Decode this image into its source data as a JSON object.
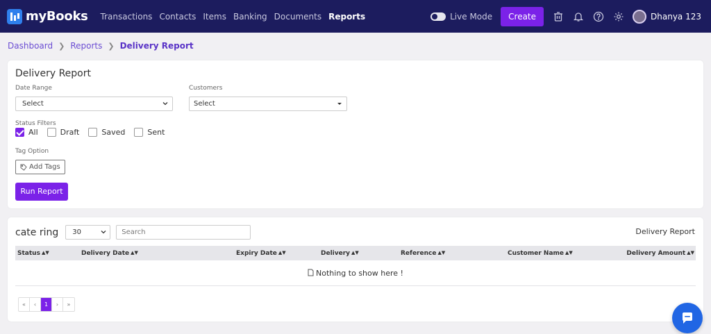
{
  "app": {
    "name": "myBooks"
  },
  "nav": {
    "links": [
      "Transactions",
      "Contacts",
      "Items",
      "Banking",
      "Documents",
      "Reports"
    ],
    "active": "Reports",
    "live_mode_label": "Live Mode",
    "create_label": "Create",
    "user_name": "Dhanya 123"
  },
  "breadcrumb": [
    "Dashboard",
    "Reports",
    "Delivery Report"
  ],
  "filters": {
    "title": "Delivery Report",
    "date_range_label": "Date Range",
    "date_range_value": "Select",
    "customers_label": "Customers",
    "customers_value": "Select",
    "status_label": "Status Filters",
    "statuses": [
      {
        "label": "All",
        "checked": true
      },
      {
        "label": "Draft",
        "checked": false
      },
      {
        "label": "Saved",
        "checked": false
      },
      {
        "label": "Sent",
        "checked": false
      }
    ],
    "tag_label": "Tag Option",
    "add_tags_label": "Add Tags",
    "run_label": "Run Report"
  },
  "table": {
    "title": "cate ring",
    "page_size": "30",
    "search_placeholder": "Search",
    "right_title": "Delivery Report",
    "columns": [
      "Status",
      "Delivery Date",
      "Expiry Date",
      "Delivery",
      "Reference",
      "Customer Name",
      "Delivery Amount"
    ],
    "empty_text": "Nothing to show here !",
    "pagination": [
      "«",
      "‹",
      "1",
      "›",
      "»"
    ],
    "current_page": "1"
  },
  "colors": {
    "nav_bg": "#1c1c5e",
    "accent": "#7b22e8",
    "chat": "#2166e4"
  }
}
